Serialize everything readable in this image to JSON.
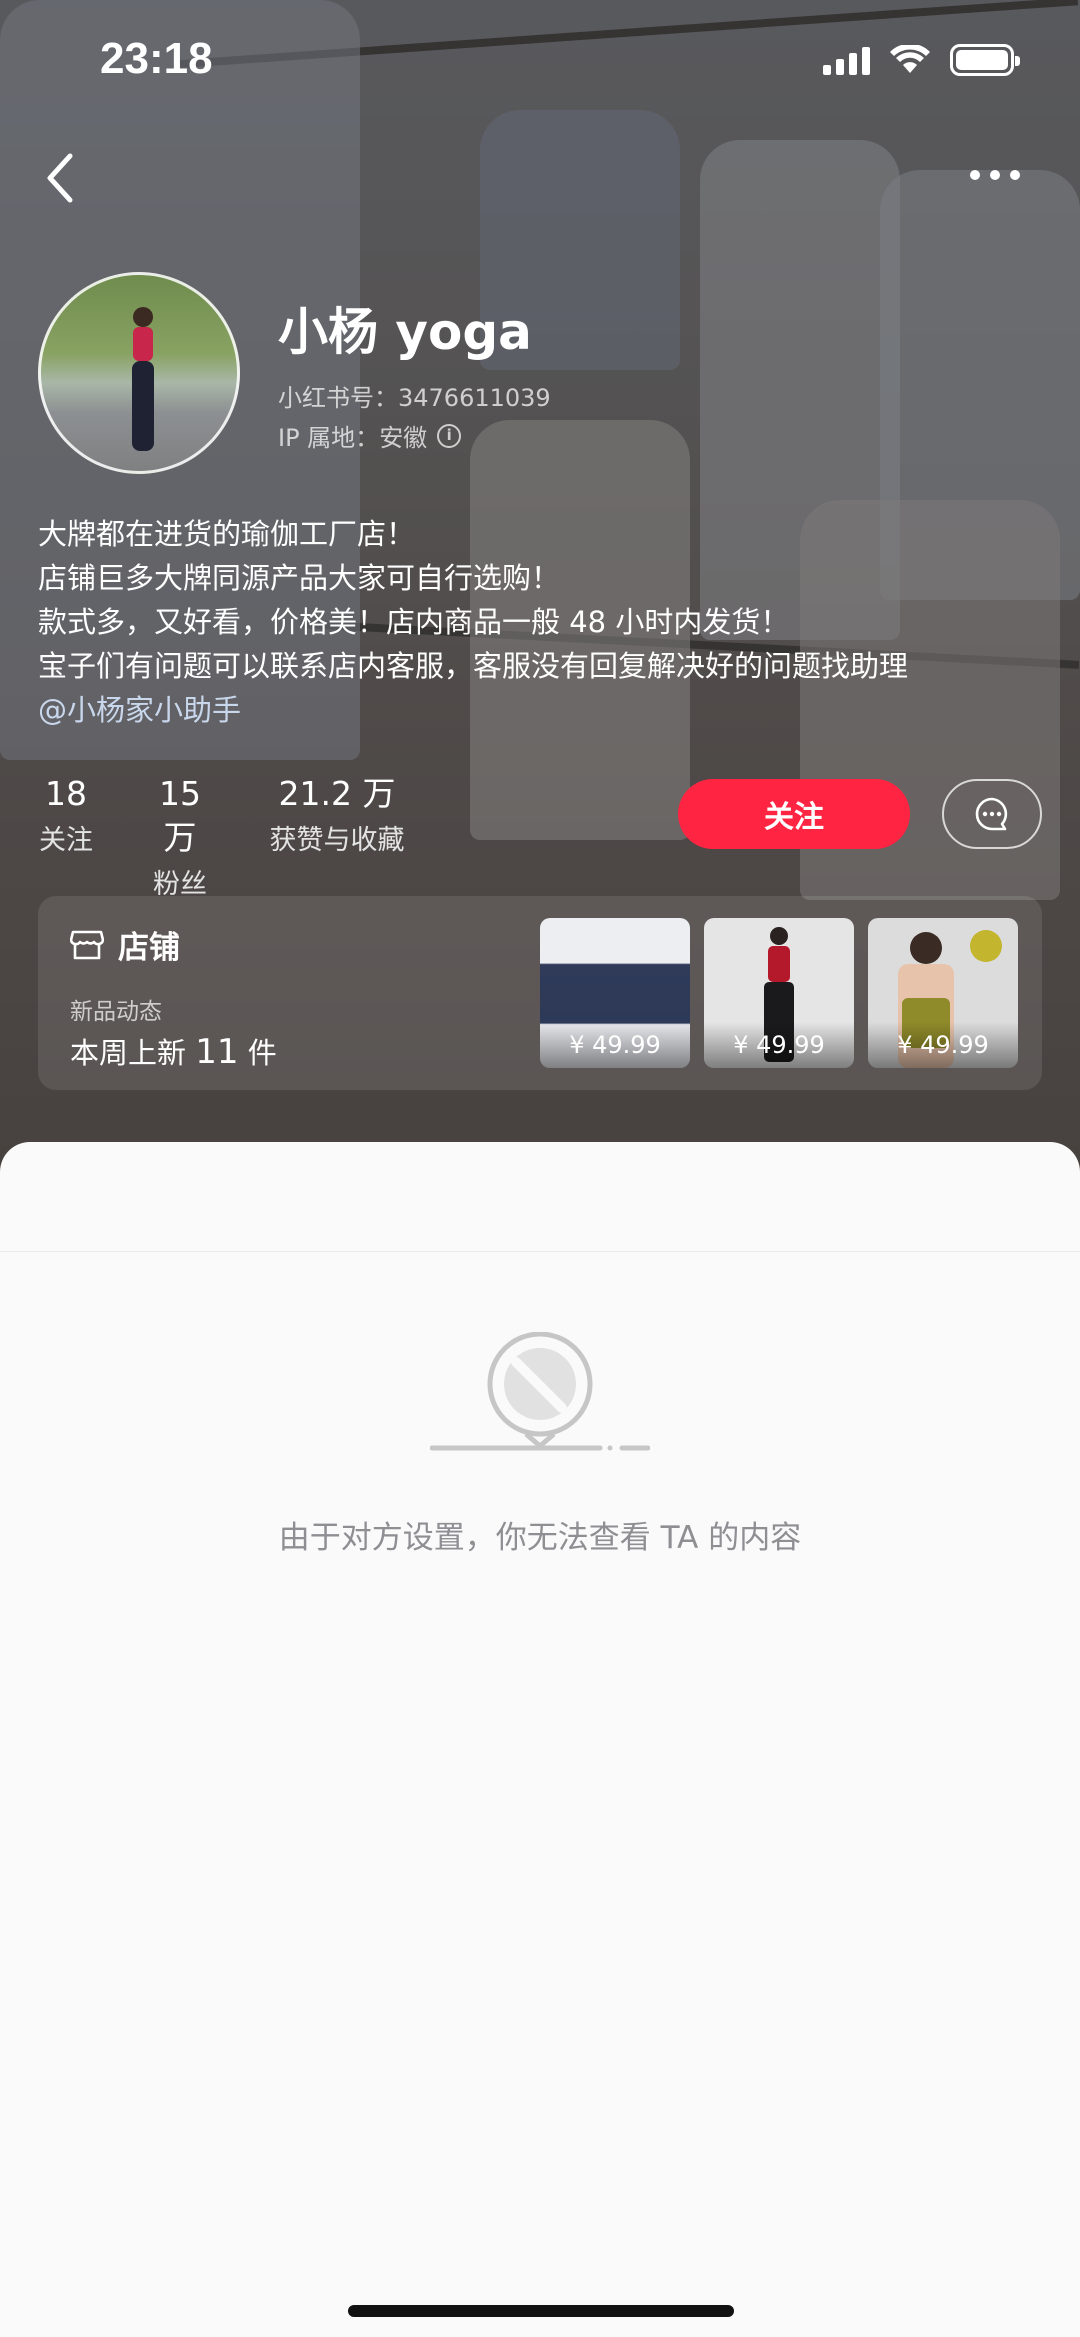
{
  "status_bar": {
    "time": "23:18"
  },
  "profile": {
    "name": "小杨 yoga",
    "id_label": "小红书号：",
    "id_value": "3476611039",
    "ip_label": "IP 属地：",
    "ip_value": "安徽"
  },
  "bio": {
    "lines": [
      "大牌都在进货的瑜伽工厂店！",
      "店铺巨多大牌同源产品大家可自行选购！",
      "款式多，又好看，价格美！店内商品一般 48 小时内发货！",
      "宝子们有问题可以联系店内客服，客服没有回复解决好的问题找助理"
    ],
    "mention": "@小杨家小助手"
  },
  "stats": [
    {
      "num": "18",
      "label": "关注"
    },
    {
      "num": "15 万",
      "label": "粉丝"
    },
    {
      "num": "21.2 万",
      "label": "获赞与收藏"
    }
  ],
  "actions": {
    "follow_label": "关注"
  },
  "store": {
    "title": "店铺",
    "sub_label": "新品动态",
    "new_prefix": "本周上新",
    "new_count": "11",
    "new_suffix": "件",
    "products": [
      {
        "price": "¥ 49.99"
      },
      {
        "price": "¥ 49.99"
      },
      {
        "price": "¥ 49.99"
      }
    ]
  },
  "empty_state": {
    "message": "由于对方设置，你无法查看 TA 的内容"
  },
  "colors": {
    "accent": "#ff2442",
    "mention": "#c9d7ec"
  }
}
